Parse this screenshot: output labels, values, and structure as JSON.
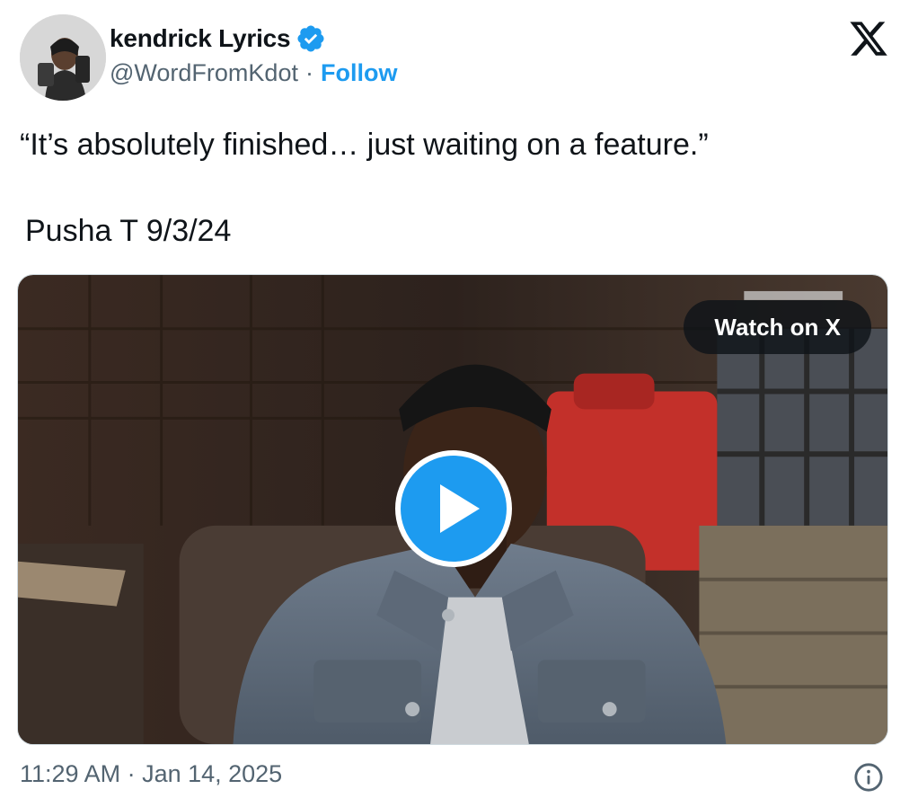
{
  "author": {
    "display_name": "kendrick Lyrics",
    "handle": "@WordFromKdot",
    "separator": "·",
    "follow_label": "Follow",
    "verified_icon": "verified-badge-icon"
  },
  "tweet": {
    "text_line1": "“It’s absolutely finished… just waiting on a feature.”",
    "text_line2": "Pusha T 9/3/24"
  },
  "media": {
    "watch_label": "Watch on X",
    "play_icon": "play-icon"
  },
  "footer": {
    "timestamp": "11:29 AM · Jan 14, 2025",
    "info_icon": "info-icon"
  },
  "colors": {
    "accent": "#1d9bf0",
    "secondary_text": "#536471",
    "primary_text": "#0f1419"
  }
}
